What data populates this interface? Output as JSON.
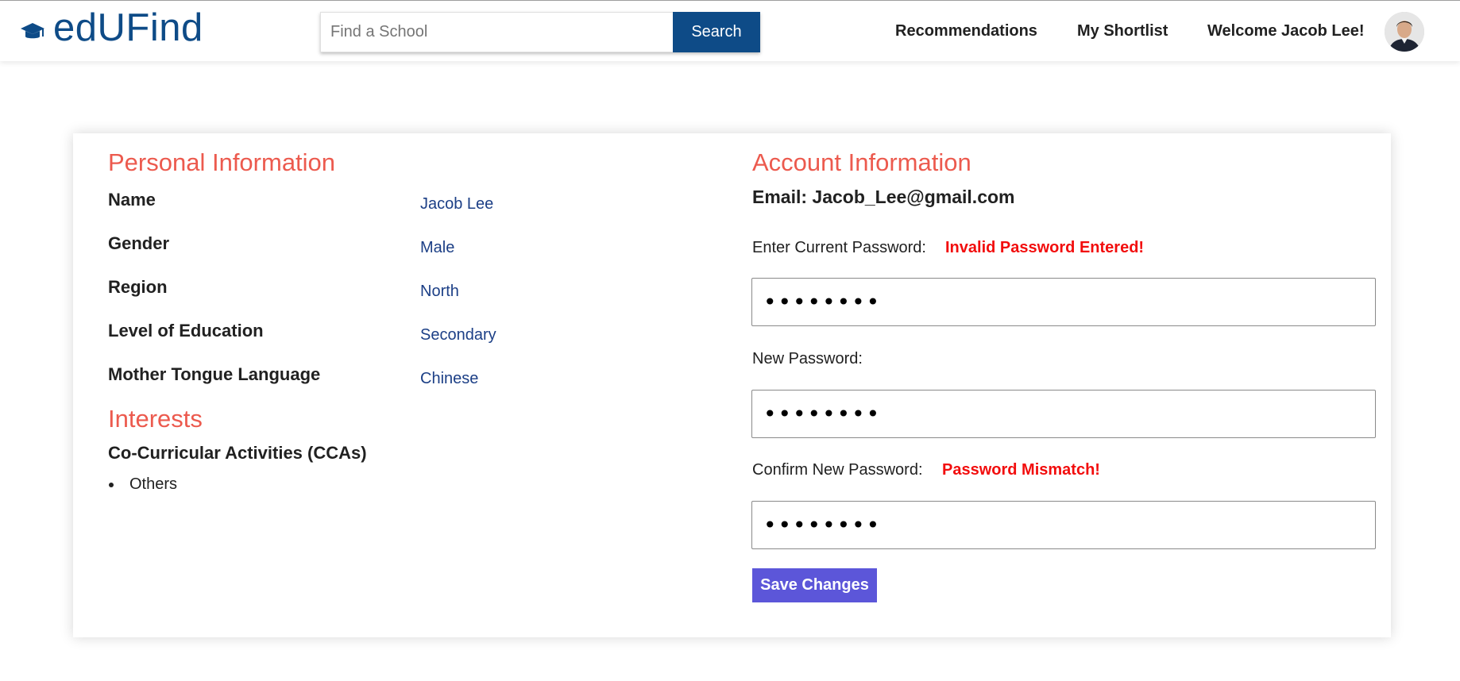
{
  "header": {
    "brand": "edUFind",
    "brand_icon": "graduation-cap-icon",
    "search_placeholder": "Find a School",
    "search_button": "Search",
    "nav": {
      "recommendations": "Recommendations",
      "shortlist": "My Shortlist",
      "welcome": "Welcome Jacob Lee!"
    },
    "accent_color": "#0e4b87"
  },
  "personal": {
    "title": "Personal Information",
    "fields": [
      {
        "label": "Name",
        "value": "Jacob Lee"
      },
      {
        "label": "Gender",
        "value": "Male"
      },
      {
        "label": "Region",
        "value": "North"
      },
      {
        "label": "Level of Education",
        "value": "Secondary"
      },
      {
        "label": "Mother Tongue Language",
        "value": "Chinese"
      }
    ]
  },
  "interests": {
    "title": "Interests",
    "ccas_label": "Co-Curricular Activities (CCAs)",
    "ccas": [
      "Others"
    ]
  },
  "account": {
    "title": "Account Information",
    "email": "Email: Jacob_Lee@gmail.com",
    "current_password_label": "Enter Current Password:",
    "current_password_error": "Invalid Password Entered!",
    "current_password_value": "••••••••",
    "new_password_label": "New Password:",
    "new_password_value": "••••••••",
    "confirm_password_label": "Confirm New Password:",
    "confirm_password_error": "Password Mismatch!",
    "confirm_password_value": "••••••••",
    "save_button": "Save Changes"
  },
  "colors": {
    "section_title": "#ec5a4e",
    "value_text": "#1c3f86",
    "error": "#f20d0d",
    "save_button": "#5c56d9"
  }
}
